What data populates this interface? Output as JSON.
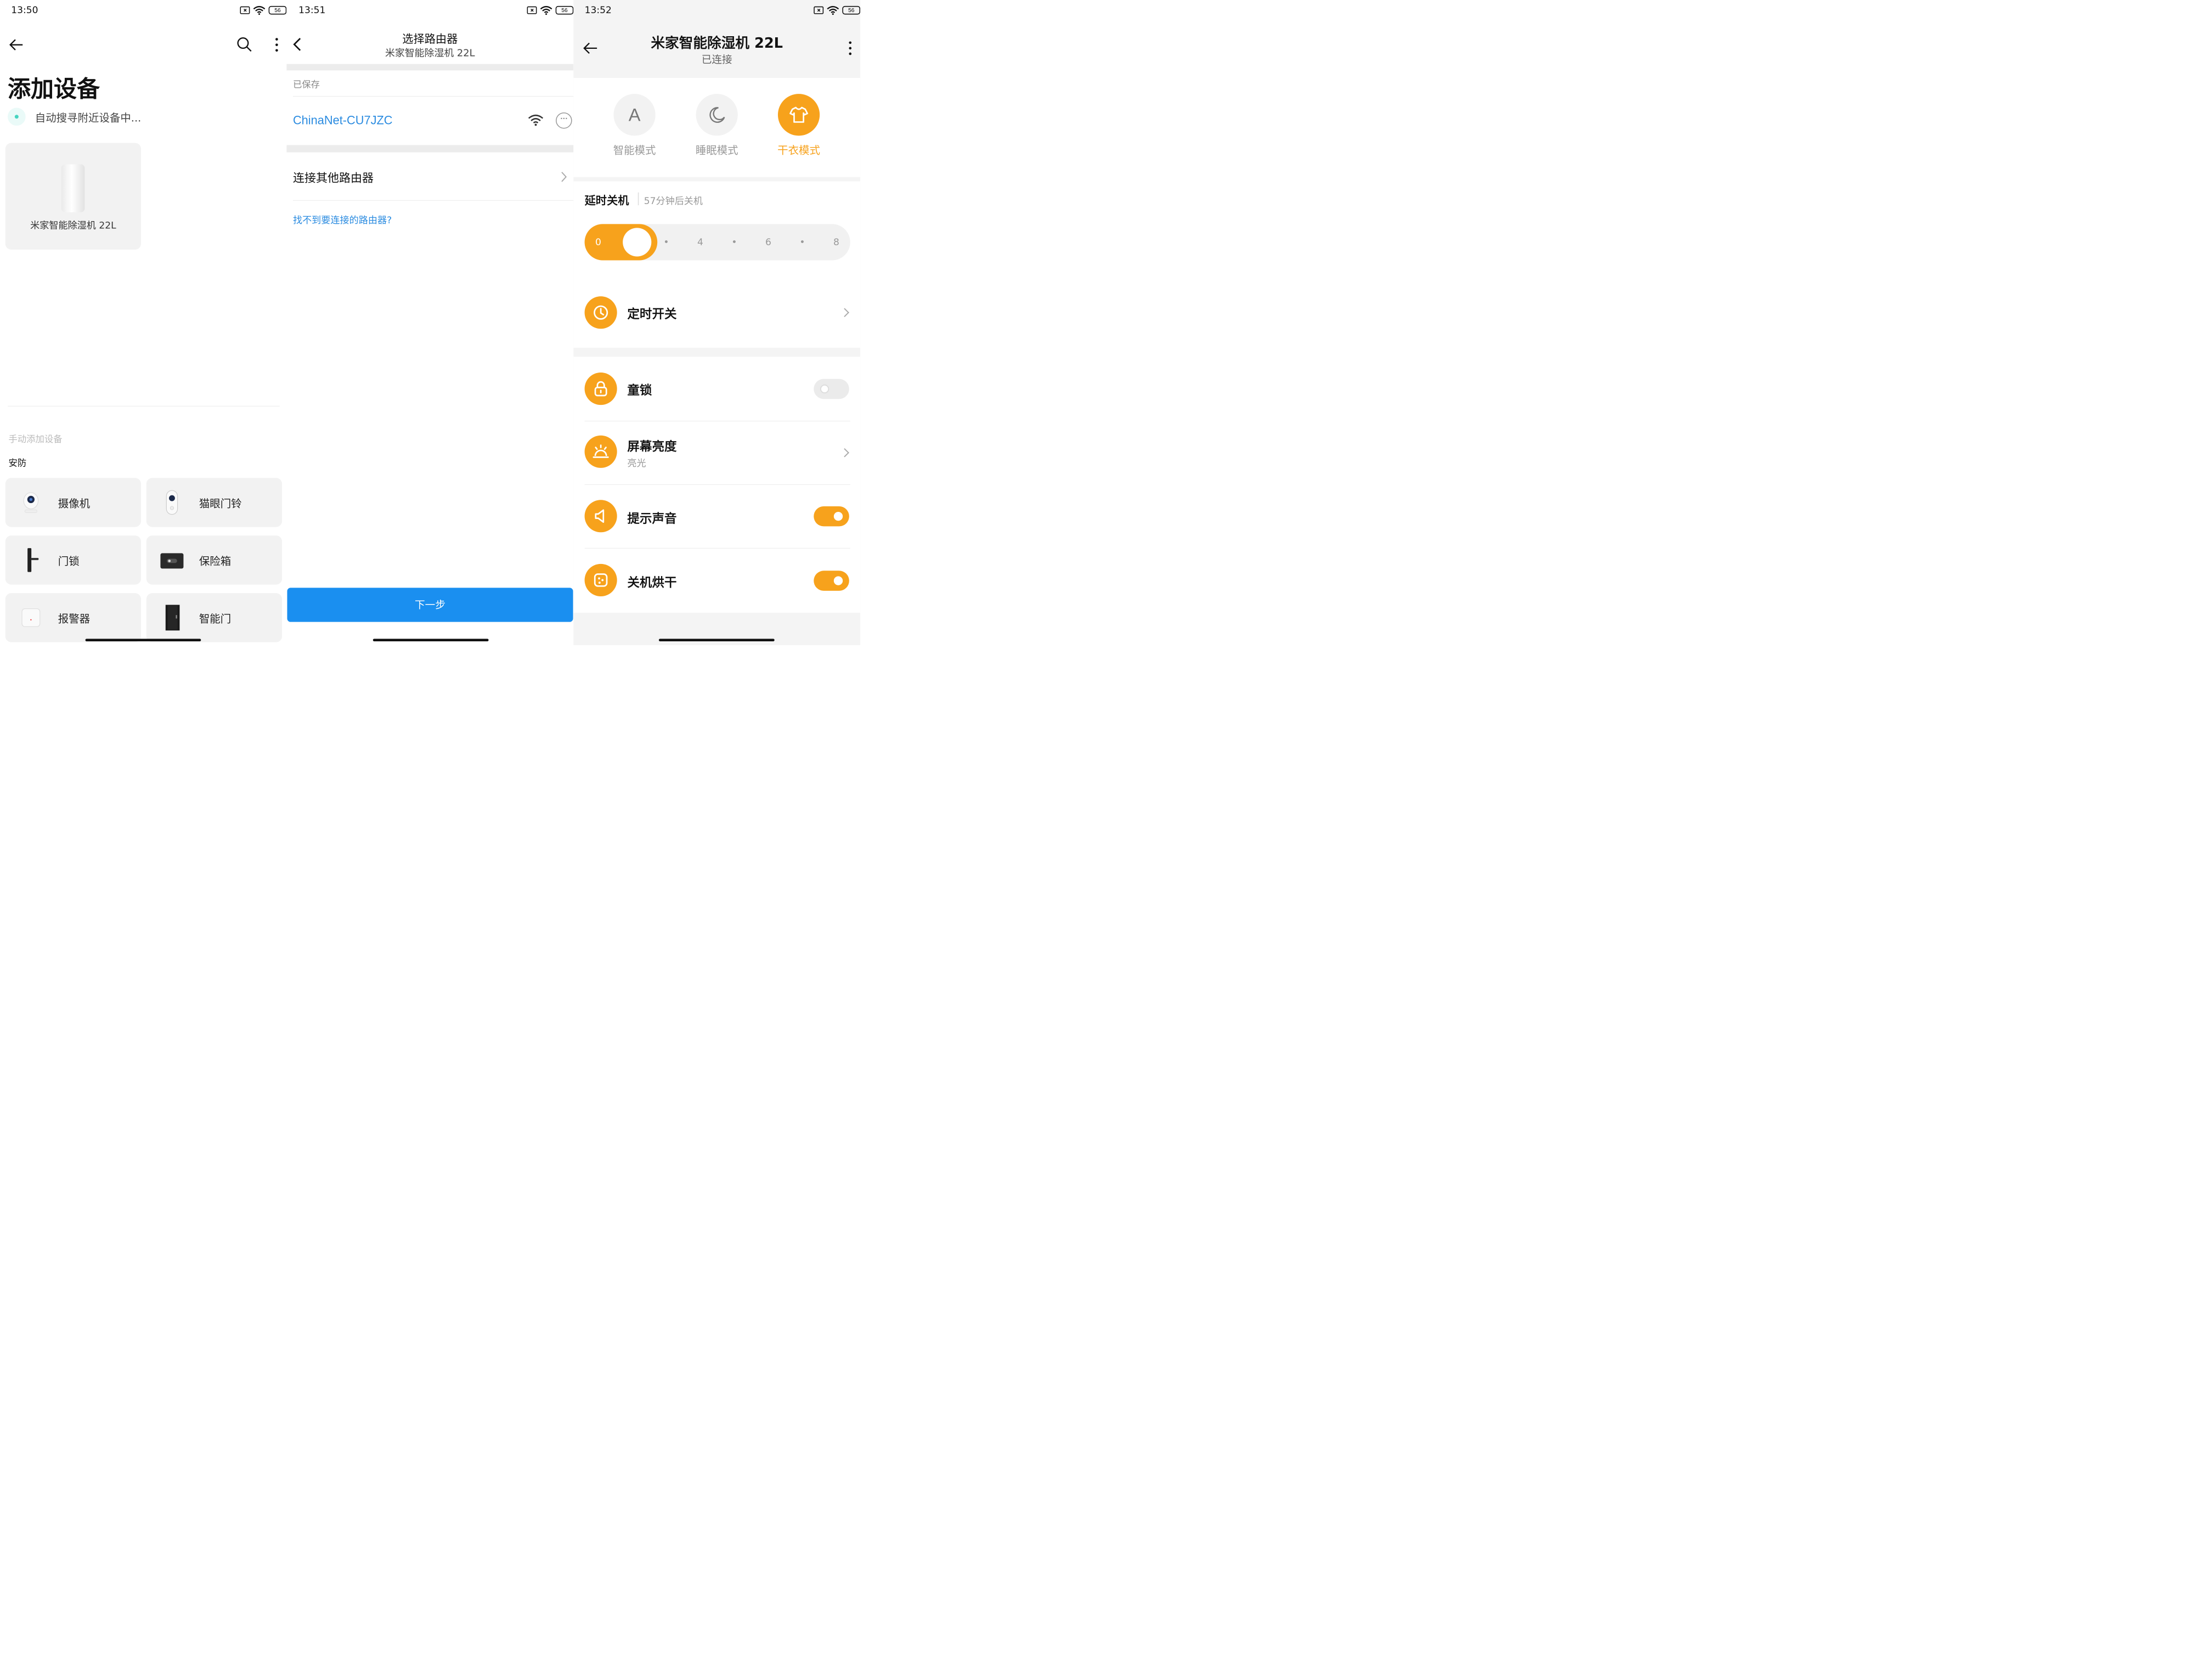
{
  "panel1": {
    "time": "13:50",
    "battery": "56",
    "title": "添加设备",
    "scanning_text": "自动搜寻附近设备中...",
    "found_device": "米家智能除湿机 22L",
    "manual_label": "手动添加设备",
    "category": "安防",
    "devices": [
      {
        "label": "摄像机",
        "icon": "camera-icon"
      },
      {
        "label": "猫眼门铃",
        "icon": "doorbell-icon"
      },
      {
        "label": "门锁",
        "icon": "door-lock-icon"
      },
      {
        "label": "保险箱",
        "icon": "safe-icon"
      },
      {
        "label": "报警器",
        "icon": "alarm-icon"
      },
      {
        "label": "智能门",
        "icon": "smart-door-icon"
      }
    ]
  },
  "panel2": {
    "time": "13:51",
    "battery": "56",
    "title": "选择路由器",
    "subtitle": "米家智能除湿机 22L",
    "saved_label": "已保存",
    "ssid": "ChinaNet-CU7JZC",
    "more_glyph": "···",
    "other_router": "连接其他路由器",
    "help_link": "找不到要连接的路由器?",
    "next_button": "下一步"
  },
  "panel3": {
    "time": "13:52",
    "battery": "56",
    "title": "米家智能除湿机 22L",
    "status": "已连接",
    "accent": "#f7a21c",
    "modes": [
      {
        "label": "智能模式",
        "glyph": "A",
        "active": false
      },
      {
        "label": "睡眠模式",
        "glyph": "☾",
        "active": false
      },
      {
        "label": "干衣模式",
        "glyph": "shirt",
        "active": true
      }
    ],
    "timer_title": "延时关机",
    "timer_value": "57分钟后关机",
    "slider_ticks": [
      "0",
      "2",
      "•",
      "4",
      "•",
      "6",
      "•",
      "8"
    ],
    "slider_level_hours": 0.95,
    "rows": [
      {
        "label": "定时开关",
        "icon": "clock-icon"
      },
      {
        "label": "童锁",
        "icon": "lock-icon",
        "toggle": false
      },
      {
        "label": "屏幕亮度",
        "sub": "亮光",
        "icon": "brightness-icon"
      },
      {
        "label": "提示声音",
        "icon": "speaker-icon",
        "toggle": true
      },
      {
        "label": "关机烘干",
        "icon": "dry-icon",
        "toggle": true
      }
    ]
  }
}
